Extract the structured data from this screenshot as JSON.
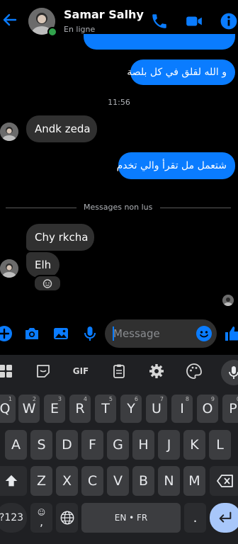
{
  "header": {
    "contact_name": "Samar Salhy",
    "status": "En ligne"
  },
  "messages": {
    "outgoing_1": "و الله لقلق في كل بلصة",
    "timestamp": "11:56",
    "incoming_1": "Andk zeda",
    "outgoing_2": "شتعمل مل تقرأ والي تخدم",
    "unread_divider": "Messages non lus",
    "incoming_2": "Chy rkcha",
    "incoming_3": "Elh"
  },
  "composer": {
    "placeholder": "Message"
  },
  "keyboard": {
    "toolbar_gif": "GIF",
    "row1": [
      {
        "k": "Q",
        "s": "1"
      },
      {
        "k": "W",
        "s": "2"
      },
      {
        "k": "E",
        "s": "3"
      },
      {
        "k": "R",
        "s": "4"
      },
      {
        "k": "T",
        "s": "5"
      },
      {
        "k": "Y",
        "s": "6"
      },
      {
        "k": "U",
        "s": "7"
      },
      {
        "k": "I",
        "s": "8"
      },
      {
        "k": "O",
        "s": "9"
      },
      {
        "k": "P",
        "s": "0"
      }
    ],
    "row2": [
      "A",
      "S",
      "D",
      "F",
      "G",
      "H",
      "J",
      "K",
      "L"
    ],
    "row3": [
      "Z",
      "X",
      "C",
      "V",
      "B",
      "N",
      "M"
    ],
    "symbols_key": "?123",
    "space_label": "EN • FR",
    "period_key": ".",
    "emoji_key": "☺",
    "comma_key": ","
  },
  "colors": {
    "accent": "#0a7cff",
    "incoming_bubble": "#303030",
    "online": "#31a24c"
  },
  "icons": [
    "back-arrow-icon",
    "phone-icon",
    "video-camera-icon",
    "info-icon",
    "plus-icon",
    "camera-icon",
    "image-icon",
    "microphone-icon",
    "emoji-icon",
    "thumbs-up-icon"
  ]
}
